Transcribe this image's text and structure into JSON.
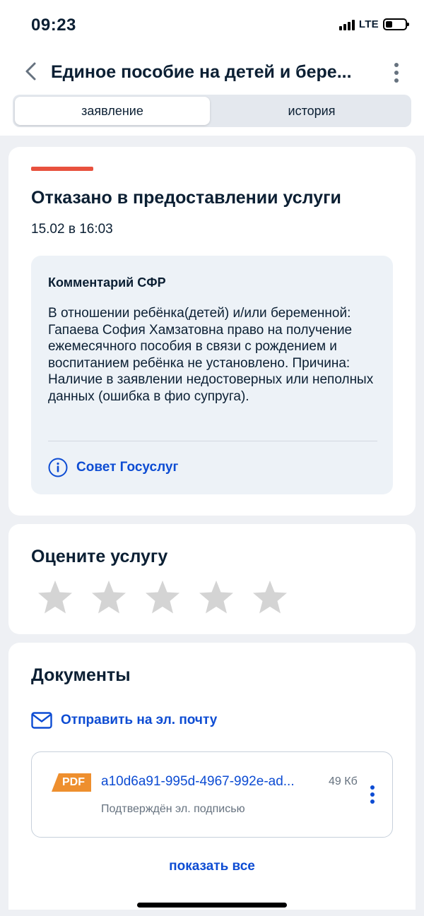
{
  "status_bar": {
    "time": "09:23",
    "network": "LTE"
  },
  "header": {
    "title": "Единое пособие на детей и бере...",
    "back_icon": "chevron-left-icon",
    "more_icon": "dots-vertical-icon"
  },
  "tabs": [
    {
      "label": "заявление",
      "active": true
    },
    {
      "label": "история",
      "active": false
    }
  ],
  "status_card": {
    "accent_color": "#e8513e",
    "title": "Отказано в предоставлении услуги",
    "date": "15.02 в 16:03",
    "comment": {
      "title": "Комментарий СФР",
      "text": "В отношении ребёнка(детей) и/или беременной: Гапаева София Хамзатовна право на получение ежемесячного пособия в связи с рождением и воспитанием ребёнка не установлено. Причина: Наличие в заявлении недостоверных или неполных данных (ошибка в фио супруга).",
      "advice_label": "Совет Госуслуг",
      "advice_icon": "info-icon"
    }
  },
  "rating": {
    "title": "Оцените услугу",
    "stars_total": 5,
    "stars_selected": 0,
    "star_color": "#d4d4d4"
  },
  "documents": {
    "title": "Документы",
    "email_label": "Отправить на эл. почту",
    "email_icon": "mail-icon",
    "items": [
      {
        "type": "PDF",
        "name": "a10d6a91-995d-4967-992e-ad...",
        "size": "49 Кб",
        "status": "Подтверждён эл. подписью",
        "badge_color": "#ee8f2e"
      }
    ],
    "show_all_label": "показать все"
  },
  "colors": {
    "link": "#0d4cd3",
    "text": "#0b1f33",
    "secondary": "#66727f"
  }
}
